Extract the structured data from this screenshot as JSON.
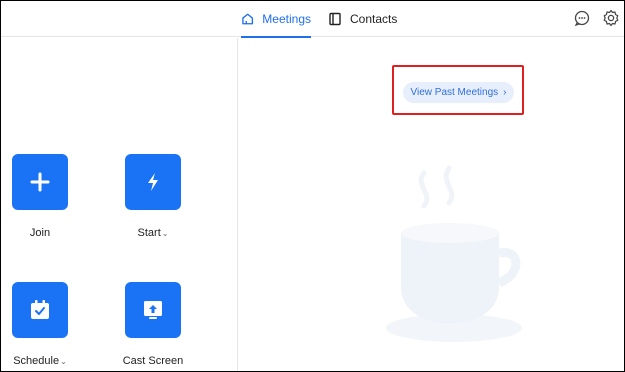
{
  "tabs": {
    "meetings": "Meetings",
    "contacts": "Contacts"
  },
  "actions": {
    "join": "Join",
    "start": "Start",
    "schedule": "Schedule",
    "cast_screen": "Cast Screen"
  },
  "history": {
    "view_past_meetings": "View Past Meetings"
  },
  "colors": {
    "accent": "#1f6feb",
    "tile": "#1a73f5",
    "highlight": "#e02020"
  },
  "icons": [
    "home-icon",
    "contacts-book-icon",
    "chat-icon",
    "gear-icon",
    "plus-icon",
    "lightning-icon",
    "calendar-check-icon",
    "cast-screen-icon",
    "coffee-cup-illustration"
  ]
}
